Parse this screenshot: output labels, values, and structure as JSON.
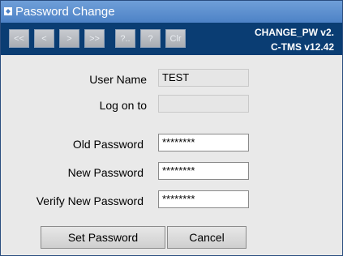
{
  "window": {
    "title": "Password Change",
    "version_line1": "CHANGE_PW v2.",
    "version_line2": "C-TMS v12.42"
  },
  "toolbar": {
    "buttons": [
      {
        "label": "<<"
      },
      {
        "label": "<"
      },
      {
        "label": ">"
      },
      {
        "label": ">>"
      },
      {
        "label": "?.."
      },
      {
        "label": "?"
      },
      {
        "label": "Clr"
      }
    ]
  },
  "form": {
    "user_name": {
      "label": "User Name",
      "value": "TEST"
    },
    "log_on_to": {
      "label": "Log on to",
      "value": ""
    },
    "old_password": {
      "label": "Old Password",
      "value": "********"
    },
    "new_password": {
      "label": "New Password",
      "value": "********"
    },
    "verify_password": {
      "label": "Verify New Password",
      "value": "********"
    }
  },
  "actions": {
    "set_password": "Set Password",
    "cancel": "Cancel"
  },
  "colors": {
    "title_bar": "#5a8bcc",
    "toolbar": "#0a3d73",
    "window_bg": "#e9e9e9"
  }
}
